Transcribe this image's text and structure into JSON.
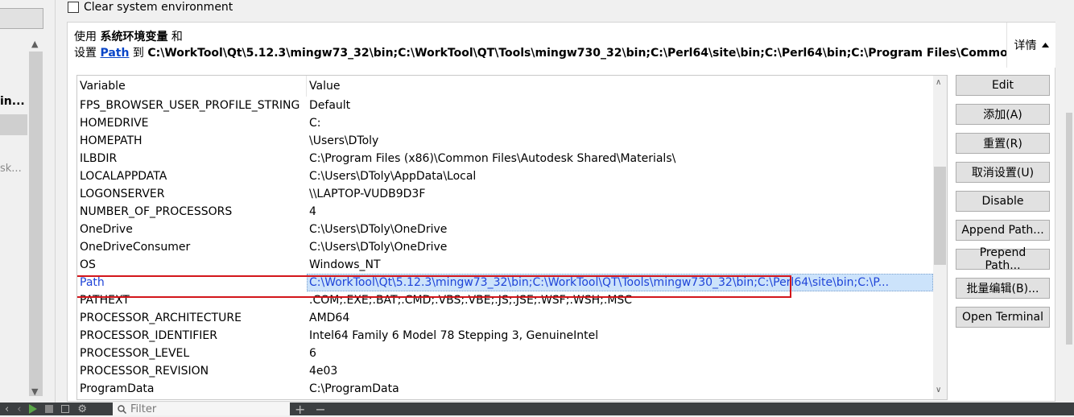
{
  "left_pane": {
    "bold_text": "in...",
    "gray_text": "sk..."
  },
  "clear_env_label": "Clear system environment",
  "summary": {
    "line1_prefix": "使用",
    "line1_bold": "系统环境变量",
    "line1_suffix": "和",
    "line2_prefix": "设置",
    "line2_link": "Path",
    "line2_to": "到",
    "line2_value": "C:\\WorkTool\\Qt\\5.12.3\\mingw73_32\\bin;C:\\WorkTool\\QT\\Tools\\mingw730_32\\bin;C:\\Perl64\\site\\bin;C:\\Perl64\\bin;C:\\Program Files\\Common"
  },
  "details_toggle": {
    "label": "详情",
    "icon": "caret-up-icon"
  },
  "table": {
    "headers": {
      "variable": "Variable",
      "value": "Value"
    },
    "rows": [
      {
        "variable": "FPS_BROWSER_USER_PROFILE_STRING",
        "value": "Default"
      },
      {
        "variable": "HOMEDRIVE",
        "value": "C:"
      },
      {
        "variable": "HOMEPATH",
        "value": "\\Users\\DToly"
      },
      {
        "variable": "ILBDIR",
        "value": "C:\\Program Files (x86)\\Common Files\\Autodesk Shared\\Materials\\"
      },
      {
        "variable": "LOCALAPPDATA",
        "value": "C:\\Users\\DToly\\AppData\\Local"
      },
      {
        "variable": "LOGONSERVER",
        "value": "\\\\LAPTOP-VUDB9D3F"
      },
      {
        "variable": "NUMBER_OF_PROCESSORS",
        "value": "4"
      },
      {
        "variable": "OneDrive",
        "value": "C:\\Users\\DToly\\OneDrive"
      },
      {
        "variable": "OneDriveConsumer",
        "value": "C:\\Users\\DToly\\OneDrive"
      },
      {
        "variable": "OS",
        "value": "Windows_NT"
      },
      {
        "variable": "Path",
        "value": "C:\\WorkTool\\Qt\\5.12.3\\mingw73_32\\bin;C:\\WorkTool\\QT\\Tools\\mingw730_32\\bin;C:\\Perl64\\site\\bin;C:\\P..."
      },
      {
        "variable": "PATHEXT",
        "value": ".COM;.EXE;.BAT;.CMD;.VBS;.VBE;.JS;.JSE;.WSF;.WSH;.MSC"
      },
      {
        "variable": "PROCESSOR_ARCHITECTURE",
        "value": "AMD64"
      },
      {
        "variable": "PROCESSOR_IDENTIFIER",
        "value": "Intel64 Family 6 Model 78 Stepping 3, GenuineIntel"
      },
      {
        "variable": "PROCESSOR_LEVEL",
        "value": "6"
      },
      {
        "variable": "PROCESSOR_REVISION",
        "value": "4e03"
      },
      {
        "variable": "ProgramData",
        "value": "C:\\ProgramData"
      }
    ],
    "selected_variable": "Path"
  },
  "buttons": {
    "edit": "Edit",
    "add": "添加(A)",
    "reset": "重置(R)",
    "unset": "取消设置(U)",
    "disable": "Disable",
    "append_path": "Append Path...",
    "prepend_path": "Prepend Path...",
    "batch_edit": "批量编辑(B)...",
    "open_terminal": "Open Terminal"
  },
  "bottom_bar": {
    "filter_placeholder": "Filter"
  },
  "colors": {
    "selection_text": "#1f44d8",
    "selection_bg": "#cce3fb",
    "highlight_border": "#d3161b",
    "link": "#0a46c8"
  }
}
